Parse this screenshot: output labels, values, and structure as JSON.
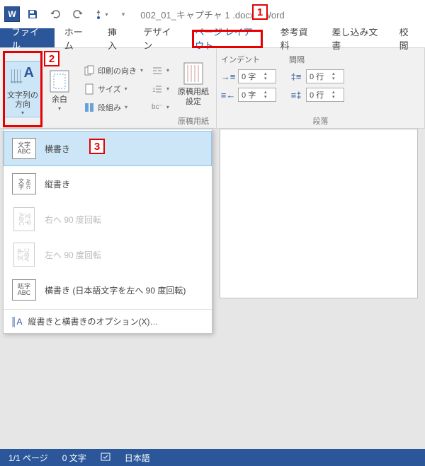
{
  "titlebar": {
    "doc_title": "002_01_キャプチャ 1 .docx - Word"
  },
  "tabs": {
    "file": "ファイル",
    "home": "ホーム",
    "insert": "挿入",
    "design": "デザイン",
    "layout": "ページ レイアウト",
    "references": "参考資料",
    "mailings": "差し込み文書",
    "review": "校閲"
  },
  "ribbon": {
    "text_direction": {
      "label": "文字列の\n方向"
    },
    "margins": {
      "label": "余白"
    },
    "orientation": "印刷の向き",
    "size": "サイズ",
    "columns": "段組み",
    "breaks": "",
    "line_numbers": "",
    "hyphenation": "",
    "manuscript": {
      "label": "原稿用紙\n設定",
      "group": "原稿用紙"
    },
    "indent_label": "インデント",
    "spacing_label": "間隔",
    "indent_left": "0 字",
    "indent_right": "0 字",
    "space_before": "0 行",
    "space_after": "0 行",
    "paragraph_group": "段落"
  },
  "dropdown": {
    "horizontal": "横書き",
    "vertical": "縦書き",
    "rotate_right": "右へ 90 度回転",
    "rotate_left": "左へ 90 度回転",
    "horizontal_rotated": "横書き (日本語文字を左へ 90 度回転)",
    "options": "縦書きと横書きのオプション(X)…"
  },
  "status": {
    "page": "1/1 ページ",
    "words": "0 文字",
    "lang": "日本語"
  },
  "callouts": {
    "n1": "1",
    "n2": "2",
    "n3": "3"
  }
}
